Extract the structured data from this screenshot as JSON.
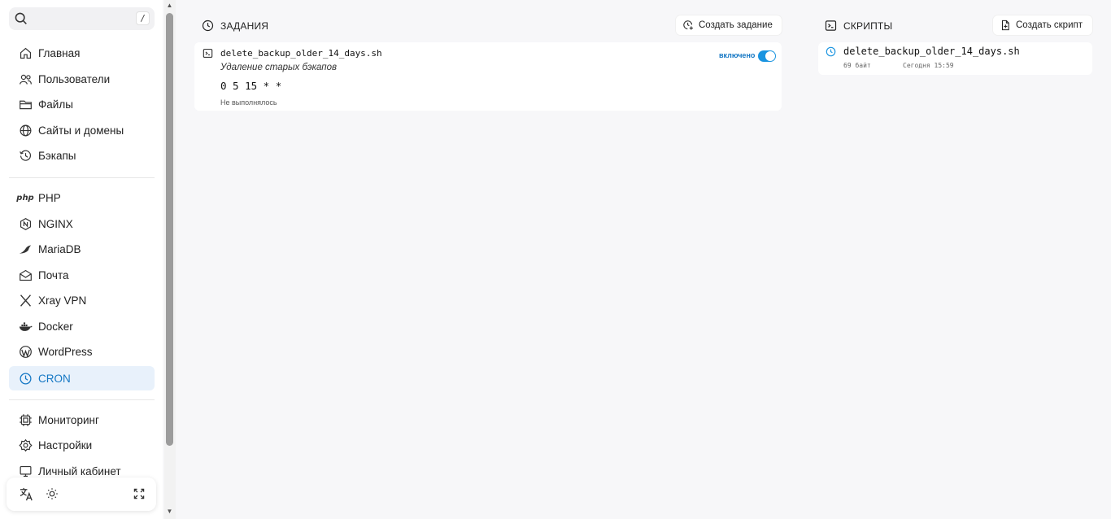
{
  "sidebar": {
    "search": {
      "shortcut": "/"
    },
    "nav_main": [
      {
        "label": "Главная",
        "icon": "home-icon"
      },
      {
        "label": "Пользователи",
        "icon": "users-icon"
      },
      {
        "label": "Файлы",
        "icon": "folder-icon"
      },
      {
        "label": "Сайты и домены",
        "icon": "globe-icon"
      },
      {
        "label": "Бэкапы",
        "icon": "history-icon"
      }
    ],
    "nav_services": [
      {
        "label": "PHP",
        "icon": "php-icon",
        "icon_text": "php"
      },
      {
        "label": "NGINX",
        "icon": "nginx-icon"
      },
      {
        "label": "MariaDB",
        "icon": "mariadb-icon"
      },
      {
        "label": "Почта",
        "icon": "mail-icon"
      },
      {
        "label": "Xray VPN",
        "icon": "xray-icon"
      },
      {
        "label": "Docker",
        "icon": "docker-icon"
      },
      {
        "label": "WordPress",
        "icon": "wordpress-icon"
      },
      {
        "label": "CRON",
        "icon": "clock-icon",
        "active": true
      }
    ],
    "nav_system": [
      {
        "label": "Мониторинг",
        "icon": "monitoring-icon"
      },
      {
        "label": "Настройки",
        "icon": "settings-icon"
      },
      {
        "label": "Личный кабинет",
        "icon": "monitor-icon"
      }
    ],
    "bottom_icons": [
      "translate-icon",
      "theme-sun-icon",
      "fullscreen-icon"
    ]
  },
  "tasks": {
    "title": "ЗАДАНИЯ",
    "create_label": "Создать задание",
    "items": [
      {
        "filename": "delete_backup_older_14_days.sh",
        "description": "Удаление старых бэкапов",
        "schedule": "0 5 15 * *",
        "status_label": "включено",
        "last_run": "Не выполнялось",
        "enabled": true
      }
    ]
  },
  "scripts": {
    "title": "СКРИПТЫ",
    "create_label": "Создать скрипт",
    "items": [
      {
        "filename": "delete_backup_older_14_days.sh",
        "size": "69 байт",
        "modified": "Сегодня 15:59"
      }
    ]
  },
  "colors": {
    "accent": "#1477c4",
    "toggle": "#1a94e0",
    "active_bg": "#e8f1fb",
    "background": "#f7f7f9"
  }
}
